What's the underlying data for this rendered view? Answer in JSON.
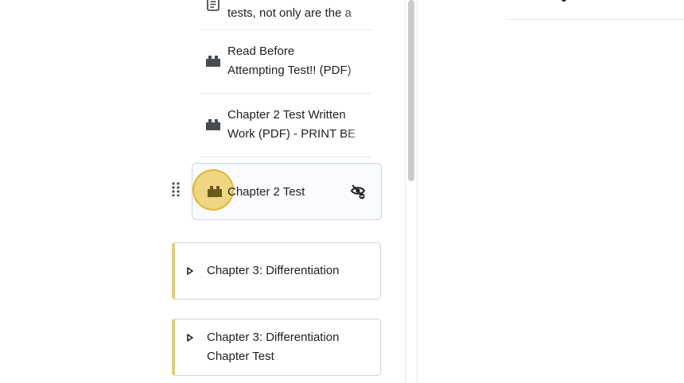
{
  "toc": {
    "topics": [
      {
        "line1": "tests, not only are the a",
        "line2": ""
      },
      {
        "line1": "Read Before",
        "line2": "Attempting Test!! (PDF)"
      },
      {
        "line1": "Chapter 2 Test Written",
        "line2": "Work (PDF) - PRINT BE"
      }
    ],
    "active_topic": {
      "title": "Chapter 2 Test"
    },
    "modules": [
      {
        "line1": "Chapter 3: Differentiation",
        "line2": ""
      },
      {
        "line1": "Chapter 3: Differentiation",
        "line2": "Chapter Test"
      }
    ]
  },
  "icons": {
    "document": "document-icon",
    "plugin": "lti-plugin-icon",
    "hidden": "visibility-hidden-icon",
    "drag": "drag-handle-icon",
    "caret": "caret-right-icon"
  },
  "colors": {
    "module_accent": "#e6cf66",
    "highlight": "#e8c240",
    "text": "#202122",
    "border": "#cdd5dc"
  }
}
